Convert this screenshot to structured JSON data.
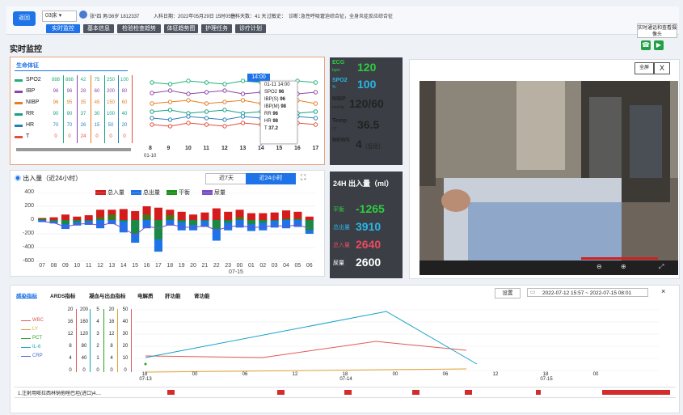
{
  "header": {
    "back_label": "返回",
    "bed": "03床",
    "patient": "张*四  男/36岁  1812337",
    "admission": "入科日期：2022年05月29日 15时05分",
    "days": "住科天数：41 天",
    "history_label": "过敏史：",
    "diagnosis_label": "诊断：",
    "diagnosis": "急性呼吸窘迫综合征，全身炎症反应综合征",
    "nav": [
      "实时监控",
      "基本信息",
      "检验检查趋势",
      "体征趋势图",
      "护理任务",
      "诊疗计划"
    ],
    "right_button": "实时通话和查看摄像头"
  },
  "page_title": "实时监控",
  "vitals_panel": {
    "title": "生命体征",
    "rows": [
      {
        "name": "SPO2",
        "color": "#22b07a",
        "cells": [
          "888",
          "888",
          "42",
          "75",
          "250",
          "100"
        ]
      },
      {
        "name": "IBP",
        "color": "#8e44ad",
        "cells": [
          "96",
          "96",
          "28",
          "60",
          "200",
          "80"
        ]
      },
      {
        "name": "NIBP",
        "color": "#e67e22",
        "cells": [
          "96",
          "95",
          "35",
          "45",
          "150",
          "60"
        ]
      },
      {
        "name": "RR",
        "color": "#16a085",
        "cells": [
          "90",
          "90",
          "37",
          "30",
          "100",
          "40"
        ]
      },
      {
        "name": "HR",
        "color": "#2980b9",
        "cells": [
          "70",
          "70",
          "26",
          "15",
          "50",
          "20"
        ]
      },
      {
        "name": "T",
        "color": "#e74c3c",
        "cells": [
          "0",
          "0",
          "24",
          "0",
          "0",
          "0"
        ]
      }
    ],
    "times": [
      "8",
      "9",
      "10",
      "11",
      "12",
      "13",
      "14",
      "15",
      "16",
      "17"
    ],
    "date": "01-10",
    "highlight_time": "14:00",
    "tooltip": {
      "title": "01-11 14:00",
      "items": [
        [
          "SPO2",
          "96"
        ],
        [
          "IBP(S)",
          "96"
        ],
        [
          "IBP(M)",
          "98"
        ],
        [
          "RR",
          "96"
        ],
        [
          "HR",
          "98"
        ],
        [
          "T",
          "37.2"
        ]
      ]
    }
  },
  "io_panel": {
    "title": "出入量（近24小时）",
    "buttons": [
      "近7天",
      "近24小时"
    ],
    "legend": [
      "总入量",
      "总出量",
      "平衡",
      "尿量"
    ],
    "yticks": [
      "400",
      "200",
      "0",
      "-200",
      "-400",
      "-600"
    ],
    "xticks": [
      "07",
      "08",
      "09",
      "10",
      "11",
      "12",
      "13",
      "14",
      "15",
      "16",
      "17",
      "18",
      "19",
      "20",
      "21",
      "22",
      "23",
      "00",
      "01",
      "02",
      "03",
      "04",
      "05",
      "06"
    ],
    "xdate": "07-15",
    "chart_data": {
      "type": "bar",
      "categories": [
        "07",
        "08",
        "09",
        "10",
        "11",
        "12",
        "13",
        "14",
        "15",
        "16",
        "17",
        "18",
        "19",
        "20",
        "21",
        "22",
        "23",
        "00",
        "01",
        "02",
        "03",
        "04",
        "05",
        "06"
      ],
      "ylim": [
        -600,
        400
      ],
      "series": [
        {
          "name": "总入量",
          "values": [
            30,
            40,
            80,
            50,
            70,
            150,
            150,
            160,
            130,
            200,
            180,
            150,
            120,
            80,
            110,
            170,
            120,
            150,
            100,
            100,
            110,
            140,
            120,
            50
          ]
        },
        {
          "name": "总出量",
          "values": [
            -30,
            -50,
            -130,
            -80,
            -70,
            -120,
            -60,
            -180,
            -330,
            -120,
            -460,
            -80,
            -150,
            -150,
            -100,
            -300,
            -150,
            -110,
            -160,
            -150,
            -110,
            -120,
            -100,
            -200
          ]
        },
        {
          "name": "平衡",
          "values": [
            20,
            -20,
            -60,
            -30,
            0,
            40,
            80,
            -20,
            -200,
            80,
            -280,
            70,
            -30,
            -70,
            0,
            -130,
            -40,
            40,
            -60,
            -40,
            0,
            20,
            20,
            -150
          ]
        },
        {
          "name": "尿量",
          "values": [
            -20,
            -40,
            -100,
            -60,
            -50,
            -80,
            -40,
            -120,
            -220,
            -90,
            -120,
            -60,
            -100,
            -110,
            -80,
            -150,
            -100,
            -80,
            -110,
            -100,
            -80,
            -90,
            -70,
            -120
          ]
        }
      ]
    }
  },
  "monitor": {
    "ecg_label": "ECG",
    "ecg_unit": "bpm",
    "ecg": "120",
    "spo2_label": "SPO2",
    "spo2_unit": "%",
    "spo2": "100",
    "nibp_label": "NIBP",
    "nibp_unit": "mmHg",
    "nibp": "120/60",
    "temp_label": "Temp",
    "temp_unit": "°C",
    "temp": "36.5",
    "mews_label": "MEWS",
    "mews": "4",
    "mews_level": "(低危)"
  },
  "io24": {
    "title": "24H 出入量（ml）",
    "items": [
      {
        "label": "平衡",
        "value": "-1265",
        "color": "#2ecc40"
      },
      {
        "label": "总出量",
        "value": "3910",
        "color": "#29b6e6"
      },
      {
        "label": "总入量",
        "value": "2640",
        "color": "#e84a5f"
      },
      {
        "label": "尿量",
        "value": "2600",
        "color": "#ffffff"
      }
    ]
  },
  "video": {
    "fullscreen": "全屏",
    "close": "X"
  },
  "bottom": {
    "tabs": [
      "感染指标",
      "ARDS指标",
      "凝血与出血指标",
      "电解质",
      "肝功能",
      "肾功能"
    ],
    "settings": "设置",
    "date_range": "2022-07-12 15:57  ~  2022-07-15 08:01",
    "legend": [
      {
        "name": "WBC",
        "color": "#e05a5a"
      },
      {
        "name": "LY",
        "color": "#e0a030"
      },
      {
        "name": "PCT",
        "color": "#2aa02a"
      },
      {
        "name": "IL-6",
        "color": "#17a2c8"
      },
      {
        "name": "CRP",
        "color": "#4a6ad0"
      }
    ],
    "axis_cols": [
      [
        "20",
        "16",
        "12",
        "8",
        "4",
        "0"
      ],
      [
        "200",
        "160",
        "120",
        "80",
        "40",
        "0"
      ],
      [
        "5",
        "4",
        "3",
        "2",
        "1",
        "0"
      ],
      [
        "20",
        "16",
        "12",
        "8",
        "4",
        "0"
      ],
      [
        "50",
        "40",
        "30",
        "20",
        "10",
        "0"
      ]
    ],
    "xticks": [
      "18",
      "00",
      "06",
      "12",
      "18",
      "00",
      "06",
      "12",
      "18",
      "00"
    ],
    "xdates": [
      "07-13",
      "07-14",
      "07-15"
    ],
    "task": "1.注射用哌拉西林钠他唑巴坦(进口)4...."
  }
}
